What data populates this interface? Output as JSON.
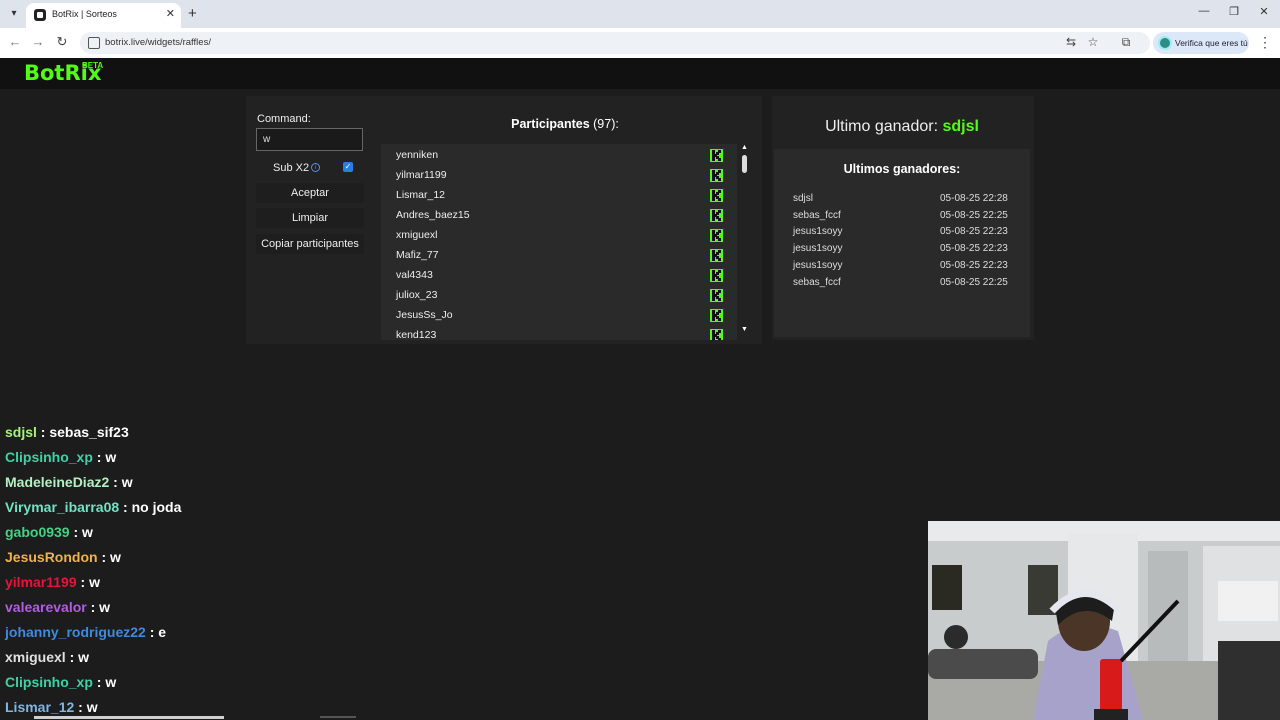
{
  "browser": {
    "tab_title": "BotRix | Sorteos",
    "url": "botrix.live/widgets/raffles/",
    "profile_label": "Verifica que eres tú"
  },
  "site": {
    "logo": "BotRix",
    "logo_badge": "BETA"
  },
  "raffle": {
    "command_label": "Command:",
    "command_value": "w",
    "sub_label": "Sub X2",
    "sub_checked": true,
    "accept_button": "Aceptar",
    "clear_button": "Limpiar",
    "copy_button": "Copiar participantes",
    "participants_label": "Participantes",
    "participants_count": "(97):",
    "participants": [
      "yenniken",
      "yilmar1199",
      "Lismar_12",
      "Andres_baez15",
      "xmiguexl",
      "Mafiz_77",
      "val4343",
      "juliox_23",
      "JesusSs_Jo",
      "kend123"
    ]
  },
  "winners": {
    "last_winner_label": "Ultimo ganador:",
    "last_winner_name": "sdjsl",
    "title": "Ultimos ganadores:",
    "list": [
      {
        "name": "sdjsl",
        "date": "05-08-25 22:28"
      },
      {
        "name": "sebas_fccf",
        "date": "05-08-25 22:25"
      },
      {
        "name": "jesus1soyy",
        "date": "05-08-25 22:23"
      },
      {
        "name": "jesus1soyy",
        "date": "05-08-25 22:23"
      },
      {
        "name": "jesus1soyy",
        "date": "05-08-25 22:23"
      },
      {
        "name": "sebas_fccf",
        "date": "05-08-25 22:25"
      }
    ]
  },
  "chat": [
    {
      "user": "sdjsl",
      "msg": " : sebas_sif23",
      "color": "#a6f27a"
    },
    {
      "user": "Clipsinho_xp",
      "msg": " : w",
      "color": "#3fd1a4"
    },
    {
      "user": "MadeleineDiaz2",
      "msg": " : w",
      "color": "#b6f0c2"
    },
    {
      "user": "Virymar_ibarra08",
      "msg": " : no joda",
      "color": "#6fe3c2"
    },
    {
      "user": "gabo0939",
      "msg": " : w",
      "color": "#43d184"
    },
    {
      "user": "JesusRondon",
      "msg": " : w",
      "color": "#f0b24a"
    },
    {
      "user": "yilmar1199",
      "msg": " : w",
      "color": "#e2173a"
    },
    {
      "user": "valearevalor",
      "msg": " : w",
      "color": "#b15be6"
    },
    {
      "user": "johanny_rodriguez22",
      "msg": " : e",
      "color": "#3d8be0"
    },
    {
      "user": "xmiguexl",
      "msg": " : w",
      "color": "#e0e0e0"
    },
    {
      "user": "Clipsinho_xp",
      "msg": " : w",
      "color": "#3fd1a4"
    },
    {
      "user": "Lismar_12",
      "msg": " : w",
      "color": "#7fb6e6"
    }
  ]
}
